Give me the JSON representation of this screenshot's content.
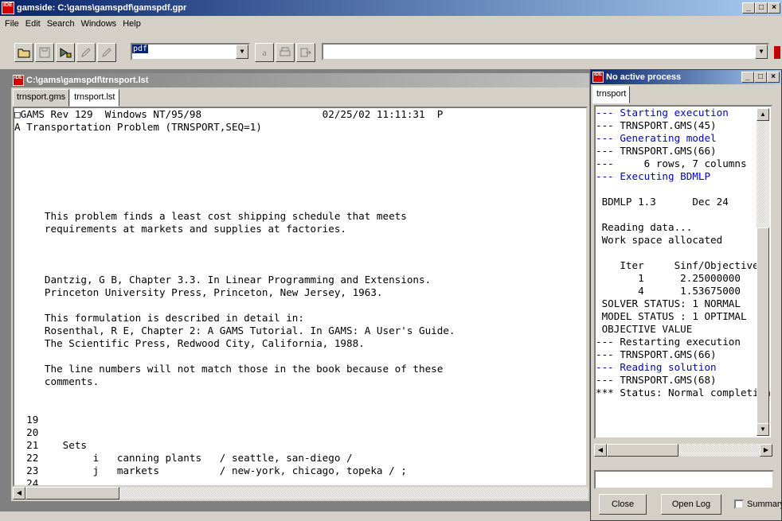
{
  "app": {
    "title": "gamside: C:\\gams\\gamspdf\\gamspdf.gpr",
    "icon_text": "IDE"
  },
  "menu": [
    "File",
    "Edit",
    "Search",
    "Windows",
    "Help"
  ],
  "toolbar": {
    "combo_value": "pdf",
    "font_label": "a"
  },
  "listing_window": {
    "title": "C:\\gams\\gamspdf\\trnsport.lst",
    "tabs": [
      "trnsport.gms",
      "trnsport.lst"
    ],
    "active_tab": 1,
    "lines": [
      "□GAMS Rev 129  Windows NT/95/98                    02/25/02 11:11:31  P",
      "A Transportation Problem (TRNSPORT,SEQ=1)",
      "",
      "",
      "",
      "",
      "",
      "",
      "     This problem finds a least cost shipping schedule that meets",
      "     requirements at markets and supplies at factories.",
      "",
      "",
      "",
      "     Dantzig, G B, Chapter 3.3. In Linear Programming and Extensions.",
      "     Princeton University Press, Princeton, New Jersey, 1963.",
      "",
      "     This formulation is described in detail in:",
      "     Rosenthal, R E, Chapter 2: A GAMS Tutorial. In GAMS: A User's Guide.",
      "     The Scientific Press, Redwood City, California, 1988.",
      "",
      "     The line numbers will not match those in the book because of these",
      "     comments.",
      "",
      "",
      "  19",
      "  20",
      "  21    Sets",
      "  22         i   canning plants   / seattle, san-diego /",
      "  23         j   markets          / new-york, chicago, topeka / ;",
      "  24"
    ]
  },
  "process_window": {
    "title": "No active process",
    "tab": "trnsport",
    "log": [
      {
        "text": "--- Starting execution",
        "blue": true
      },
      {
        "text": "--- TRNSPORT.GMS(45)",
        "blue": false
      },
      {
        "text": "--- Generating model",
        "blue": true
      },
      {
        "text": "--- TRNSPORT.GMS(66)",
        "blue": false
      },
      {
        "text": "---     6 rows, 7 columns",
        "blue": false
      },
      {
        "text": "--- Executing BDMLP",
        "blue": true
      },
      {
        "text": "",
        "blue": false
      },
      {
        "text": " BDMLP 1.3      Dec 24",
        "blue": false
      },
      {
        "text": "",
        "blue": false
      },
      {
        "text": " Reading data...",
        "blue": false
      },
      {
        "text": " Work space allocated",
        "blue": false
      },
      {
        "text": "",
        "blue": false
      },
      {
        "text": "    Iter     Sinf/Objective",
        "blue": false
      },
      {
        "text": "       1      2.25000000",
        "blue": false
      },
      {
        "text": "       4      1.53675000",
        "blue": false
      },
      {
        "text": " SOLVER STATUS: 1 NORMAL",
        "blue": false
      },
      {
        "text": " MODEL STATUS : 1 OPTIMAL",
        "blue": false
      },
      {
        "text": " OBJECTIVE VALUE",
        "blue": false
      },
      {
        "text": "--- Restarting execution",
        "blue": false
      },
      {
        "text": "--- TRNSPORT.GMS(66)",
        "blue": false
      },
      {
        "text": "--- Reading solution",
        "blue": true
      },
      {
        "text": "--- TRNSPORT.GMS(68)",
        "blue": false
      },
      {
        "text": "*** Status: Normal completion",
        "blue": false
      }
    ],
    "close_label": "Close",
    "open_log_label": "Open Log",
    "summary_label": "Summary"
  }
}
